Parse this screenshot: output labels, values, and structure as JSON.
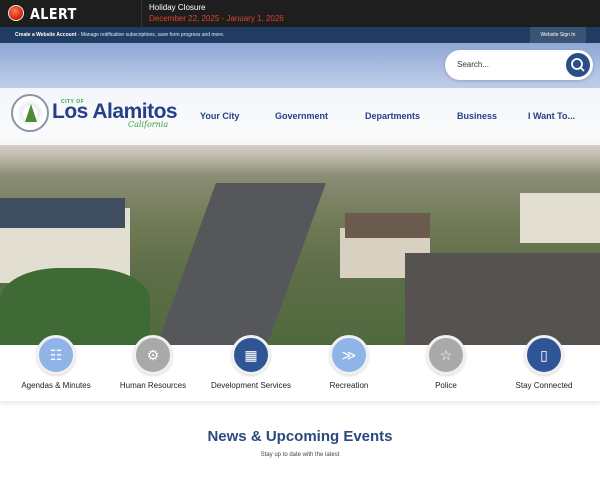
{
  "alert": {
    "label": "ALERT",
    "title": "Holiday Closure",
    "dates": "December 22, 2025 - January 1, 2026"
  },
  "account": {
    "link": "Create a Website Account",
    "desc": " - Manage notification subscriptions, save form progress and more.",
    "signin": "Website Sign In"
  },
  "search": {
    "placeholder": "Search..."
  },
  "logo": {
    "city_of": "CITY OF",
    "name": "Los Alamitos",
    "state": "California"
  },
  "nav": [
    "Your City",
    "Government",
    "Departments",
    "Business",
    "I Want To..."
  ],
  "quick_links": [
    {
      "label": "Agendas & Minutes",
      "color": "#8fb4e8",
      "icon": "meeting-icon",
      "glyph": "☷"
    },
    {
      "label": "Human Resources",
      "color": "#a9a9a9",
      "icon": "gear-person-icon",
      "glyph": "⚙"
    },
    {
      "label": "Development Services",
      "color": "#2f5596",
      "icon": "building-icon",
      "glyph": "▦"
    },
    {
      "label": "Recreation",
      "color": "#8fb4e8",
      "icon": "runner-icon",
      "glyph": "≫"
    },
    {
      "label": "Police",
      "color": "#a9a9a9",
      "icon": "shield-icon",
      "glyph": "☆"
    },
    {
      "label": "Stay Connected",
      "color": "#2f5596",
      "icon": "phone-icon",
      "glyph": "▯"
    }
  ],
  "news": {
    "title": "News & Upcoming Events",
    "subtitle": "Stay up to date with the latest"
  }
}
